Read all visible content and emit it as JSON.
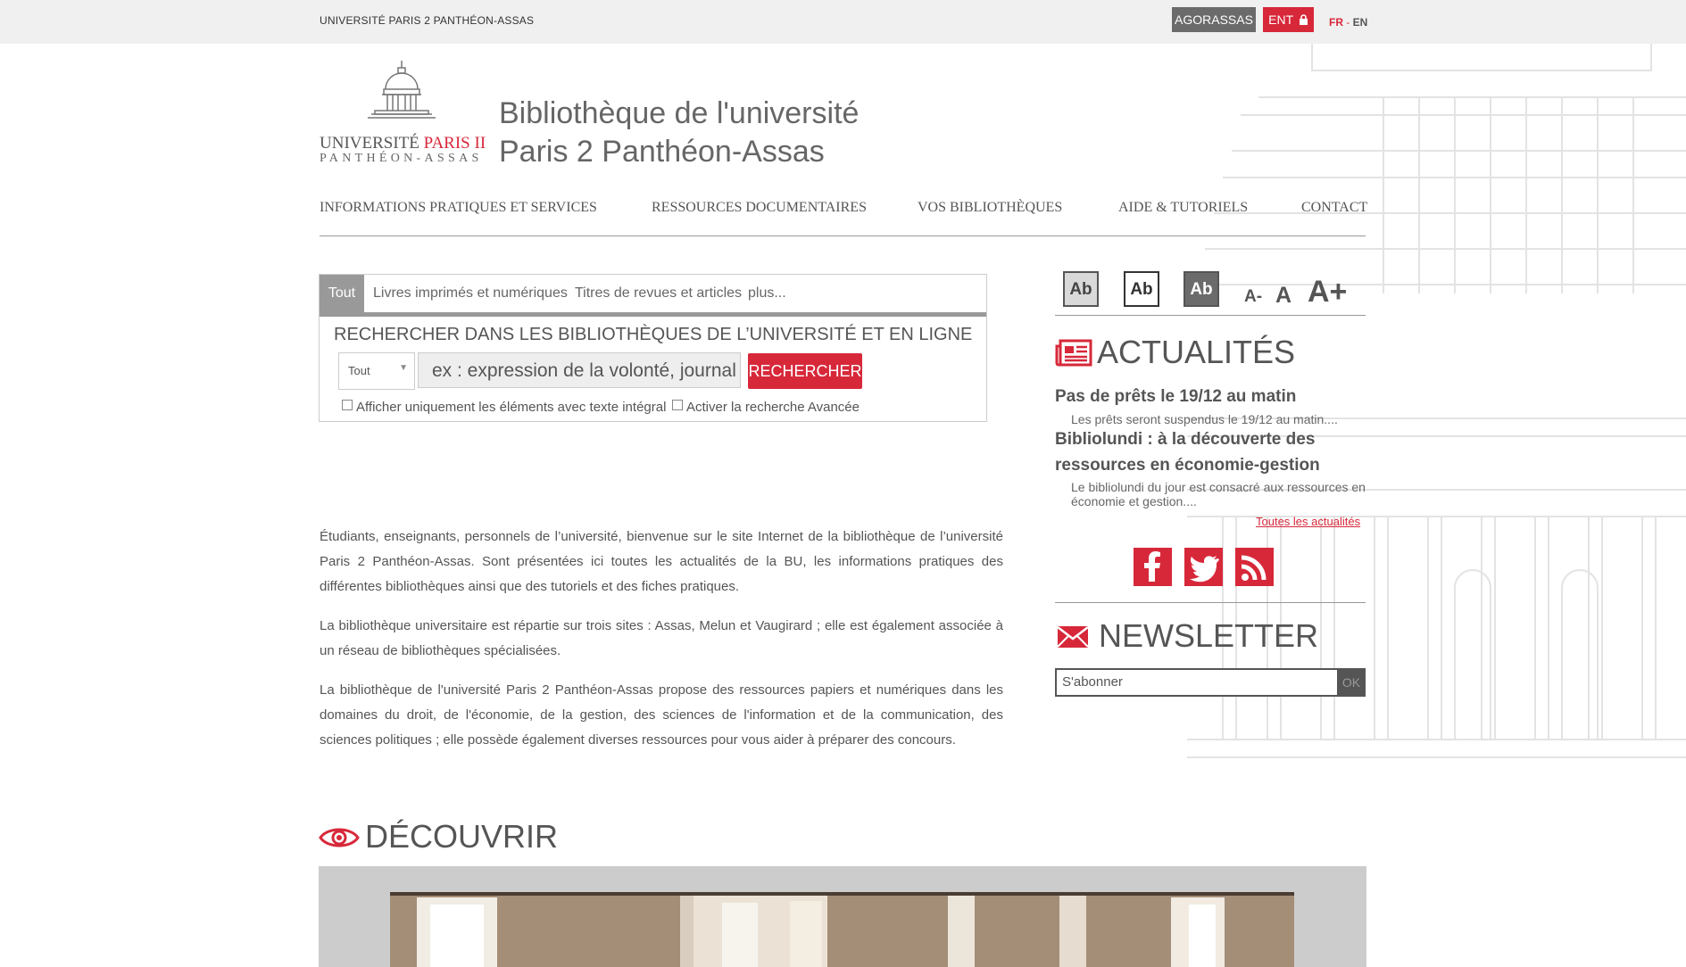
{
  "topbar": {
    "university": "UNIVERSITÉ PARIS 2 PANTHÉON-ASSAS",
    "agorassas_label": "AGORASSAS",
    "ent_label": "ENT",
    "lang_fr": "FR",
    "lang_sep": " - ",
    "lang_en": "EN"
  },
  "logo": {
    "line1_a": "UNIVERSITÉ",
    "line1_b": "PARIS II",
    "line2": "PANTHÉON-ASSAS"
  },
  "site_title": {
    "line1": "Bibliothèque de l'université",
    "line2": "Paris 2 Panthéon-Assas"
  },
  "nav": {
    "items": [
      {
        "label": "INFORMATIONS PRATIQUES ET SERVICES"
      },
      {
        "label": "RESSOURCES DOCUMENTAIRES"
      },
      {
        "label": "VOS BIBLIOTHÈQUES"
      },
      {
        "label": "AIDE & TUTORIELS"
      },
      {
        "label": "CONTACT"
      }
    ]
  },
  "search": {
    "tabs": [
      {
        "label": "Tout"
      },
      {
        "label": "Livres imprimés et numériques"
      },
      {
        "label": "Titres de revues et articles"
      },
      {
        "label": "plus..."
      }
    ],
    "heading": "RECHERCHER DANS LES BIBLIOTHÈQUES DE L’UNIVERSITÉ ET EN LIGNE",
    "select_value": "Tout",
    "placeholder": "ex : expression de la volonté, journal",
    "button_label": "RECHERCHER",
    "check_fulltext": "Afficher uniquement les éléments avec texte intégral",
    "check_advanced": "Activer la recherche Avancée"
  },
  "intro": {
    "p1": "Étudiants, enseignants, personnels de l’université, bienvenue sur le site Internet de la bibliothèque de l’université Paris 2 Panthéon-Assas. Sont présentées ici toutes les actualités de la BU, les informations pratiques des différentes bibliothèques ainsi que des tutoriels et des fiches pratiques.",
    "p2": "La bibliothèque universitaire est répartie sur trois sites : Assas, Melun et Vaugirard ; elle est également associée à un réseau de bibliothèques spécialisées.",
    "p3": "La bibliothèque de l'université Paris 2 Panthéon-Assas propose des ressources papiers et numériques dans les domaines du droit, de l'économie, de la gestion, des sciences de l'information et de la communication, des sciences politiques ; elle possède également diverses ressources pour vous aider à préparer des concours."
  },
  "accessibility": {
    "contrast1": "Ab",
    "contrast2": "Ab",
    "contrast3": "Ab",
    "font_small": "A-",
    "font_medium": "A",
    "font_large": "A+"
  },
  "news": {
    "title": "ACTUALITÉS",
    "items": [
      {
        "title": "Pas de prêts le 19/12 au matin",
        "desc": "Les prêts seront suspendus le 19/12 au matin...."
      },
      {
        "title": "Bibliolundi : à la découverte des ressources en économie-gestion",
        "desc": "Le bibliolundi du jour est consacré aux ressources en économie et gestion...."
      }
    ],
    "all_link": "Toutes les actualités"
  },
  "social": {
    "icons": [
      "facebook-icon",
      "twitter-icon",
      "rss-icon"
    ]
  },
  "newsletter": {
    "title": "NEWSLETTER",
    "placeholder": "S'abonner",
    "ok_label": "OK"
  },
  "discover": {
    "title": "DÉCOUVRIR"
  },
  "colors": {
    "accent": "#d7283a",
    "gray_dark": "#6b6b6b",
    "topbar": "#f0f0f0"
  }
}
